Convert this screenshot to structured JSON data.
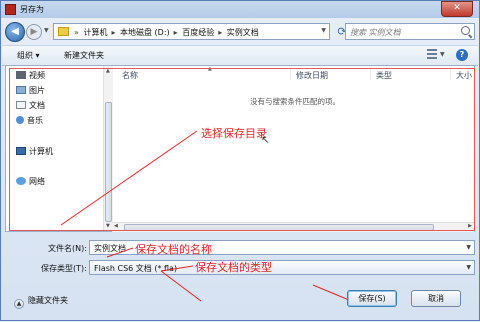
{
  "window": {
    "title": "另存为",
    "close_glyph": "✕"
  },
  "address": {
    "crumbs": [
      "计算机",
      "本地磁盘 (D:)",
      "百度经验",
      "实例文档"
    ],
    "search_placeholder": "搜索 实例文档"
  },
  "toolbar": {
    "organize": "组织 ▾",
    "new_folder": "新建文件夹",
    "help": "?"
  },
  "nav": {
    "favorites": [
      "视频",
      "图片",
      "文档",
      "音乐"
    ],
    "computer": "计算机",
    "network": "网络"
  },
  "files": {
    "columns": [
      "名称",
      "修改日期",
      "类型",
      "大小"
    ],
    "empty_message": "没有与搜索条件匹配的项。"
  },
  "form": {
    "filename_label": "文件名(N):",
    "filename_value": "实例文档",
    "filetype_label": "保存类型(T):",
    "filetype_value": "Flash CS6 文档 (*.fla)"
  },
  "buttons": {
    "hide_folders": "隐藏文件夹",
    "save": "保存(S)",
    "cancel": "取消"
  },
  "annotations": {
    "select_dir": "选择保存目录",
    "doc_name": "保存文档的名称",
    "doc_type": "保存文档的类型"
  },
  "colors": {
    "annotation": "#e0282b",
    "title_icon": "#b3261e"
  }
}
